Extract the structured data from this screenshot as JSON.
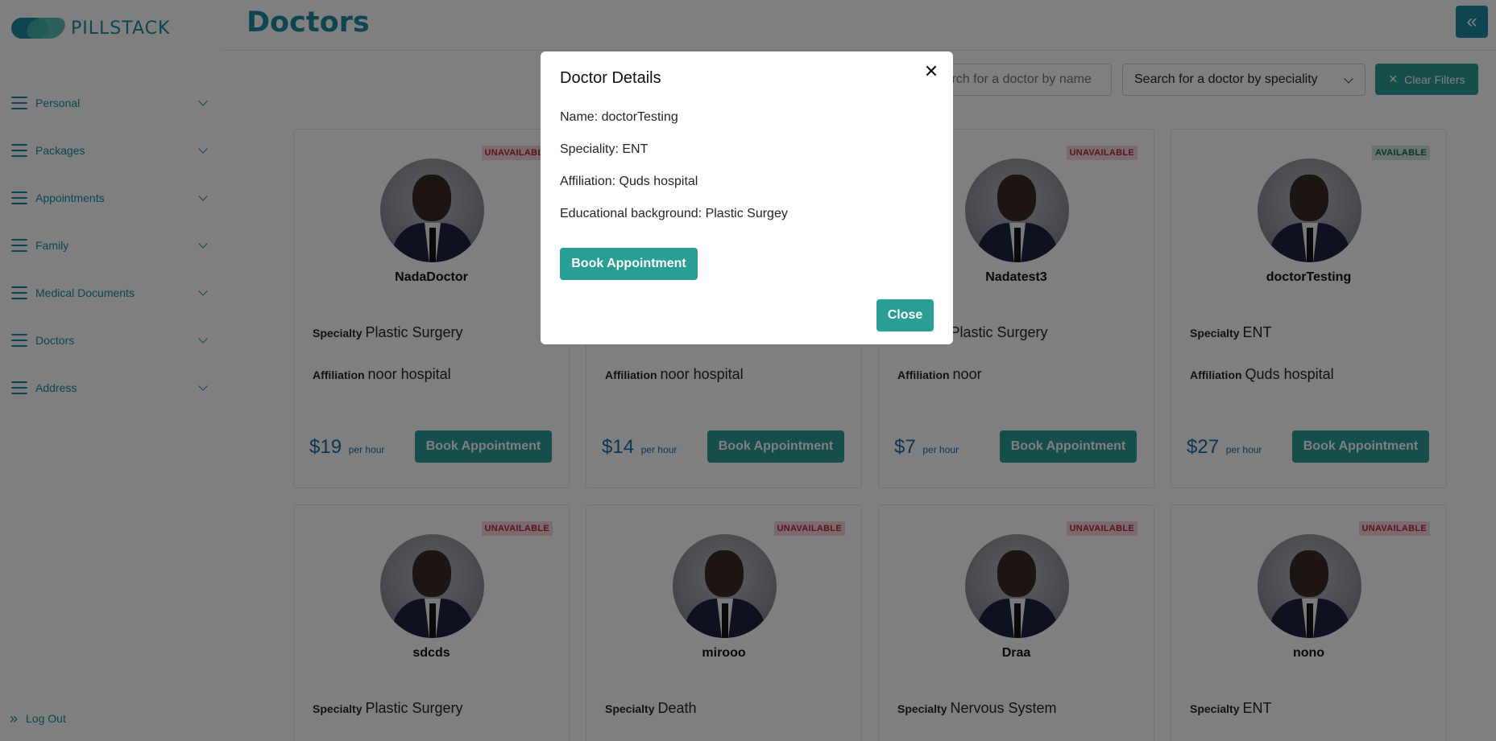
{
  "app": {
    "logo_text": "PILLSTACK",
    "page_title": "Doctors",
    "collapse_icon": "double-chevron-left-icon"
  },
  "sidebar": {
    "items": [
      {
        "label": "Personal"
      },
      {
        "label": "Packages"
      },
      {
        "label": "Appointments"
      },
      {
        "label": "Family"
      },
      {
        "label": "Medical Documents"
      },
      {
        "label": "Doctors"
      },
      {
        "label": "Address"
      }
    ],
    "logout_label": "Log Out"
  },
  "filters": {
    "name_placeholder": "Search for a doctor by name",
    "speciality_selected": "Search for a doctor by speciality",
    "clear_label": "Clear Filters"
  },
  "labels": {
    "specialty": "Specialty",
    "affiliation": "Affiliation",
    "per_hour": "per hour",
    "book": "Book Appointment"
  },
  "doctors": [
    {
      "name": "NadaDoctor",
      "status": "UNAVAILABLE",
      "specialty": "Plastic Surgery",
      "affiliation": "noor hospital",
      "price": "$19"
    },
    {
      "name": "",
      "status": "",
      "specialty": "",
      "affiliation": "noor hospital",
      "price": "$14"
    },
    {
      "name": "Nadatest3",
      "status": "UNAVAILABLE",
      "specialty": "Plastic Surgery",
      "affiliation": "noor",
      "price": "$7"
    },
    {
      "name": "doctorTesting",
      "status": "AVAILABLE",
      "specialty": "ENT",
      "affiliation": "Quds hospital",
      "price": "$27"
    },
    {
      "name": "sdcds",
      "status": "UNAVAILABLE",
      "specialty": "Plastic Surgery"
    },
    {
      "name": "mirooo",
      "status": "UNAVAILABLE",
      "specialty": "Death"
    },
    {
      "name": "Draa",
      "status": "UNAVAILABLE",
      "specialty": "Nervous System"
    },
    {
      "name": "nono",
      "status": "UNAVAILABLE",
      "specialty": "ENT"
    }
  ],
  "modal": {
    "title": "Doctor Details",
    "name_line": "Name: doctorTesting",
    "speciality_line": "Speciality: ENT",
    "affiliation_line": "Affiliation: Quds hospital",
    "education_line": "Educational background: Plastic Surgey",
    "book_label": "Book Appointment",
    "close_label": "Close"
  },
  "colors": {
    "brand": "#1c8ba3",
    "button": "#2a9d94",
    "unavailable_bg": "#f8d7da",
    "unavailable_text": "#b02a37",
    "available_bg": "#d1e7dd",
    "available_text": "#146c43"
  }
}
